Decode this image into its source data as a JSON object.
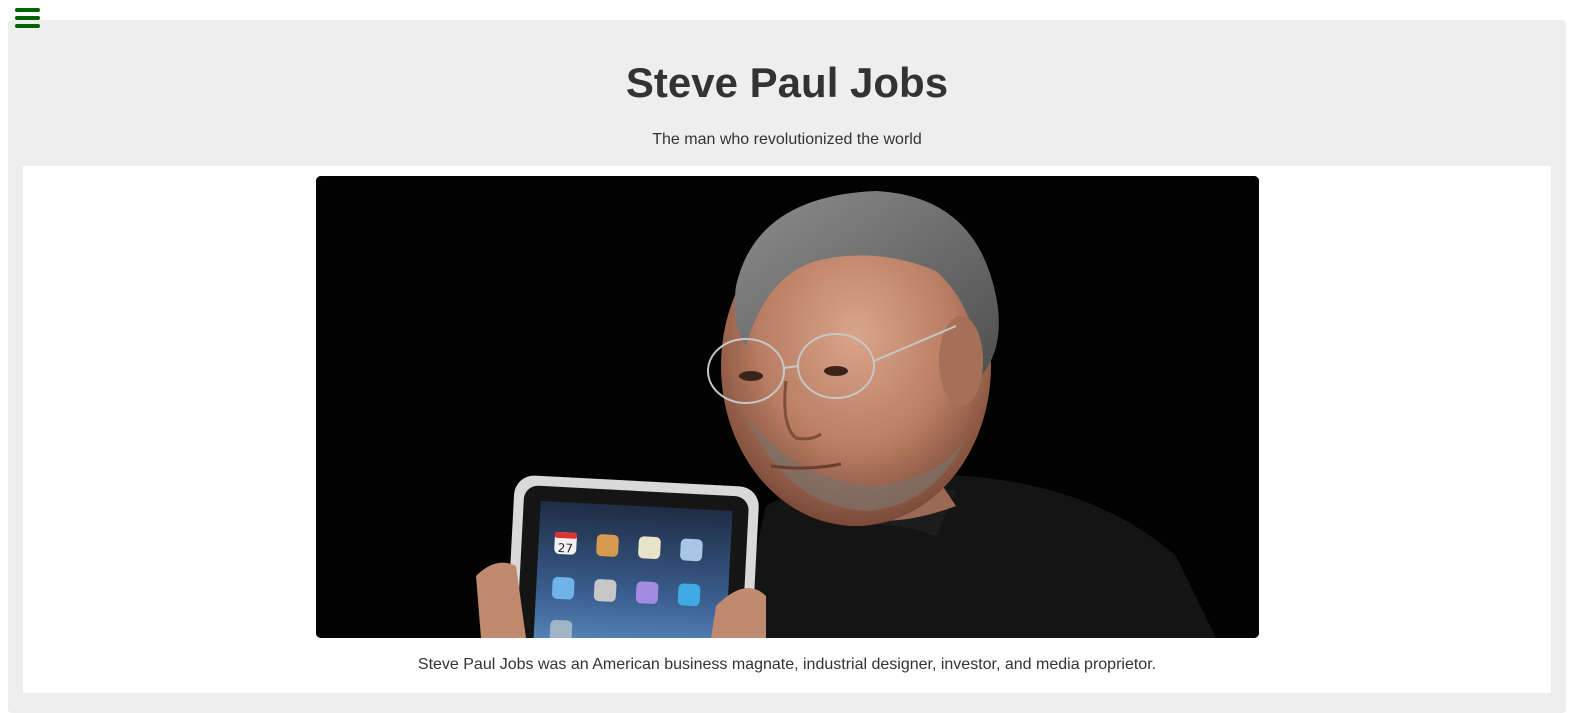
{
  "menu": {
    "icon": "hamburger-menu-icon",
    "color": "#006400"
  },
  "header": {
    "title": "Steve Paul Jobs",
    "subtitle": "The man who revolutionized the world"
  },
  "figure": {
    "image_subject": "portrait-holding-tablet",
    "caption": "Steve Paul Jobs was an American business magnate, industrial designer, investor, and media proprietor.",
    "tablet_date_digits": "27"
  },
  "colors": {
    "page_background": "#eeeeee",
    "text": "#333333",
    "accent": "#006400"
  }
}
